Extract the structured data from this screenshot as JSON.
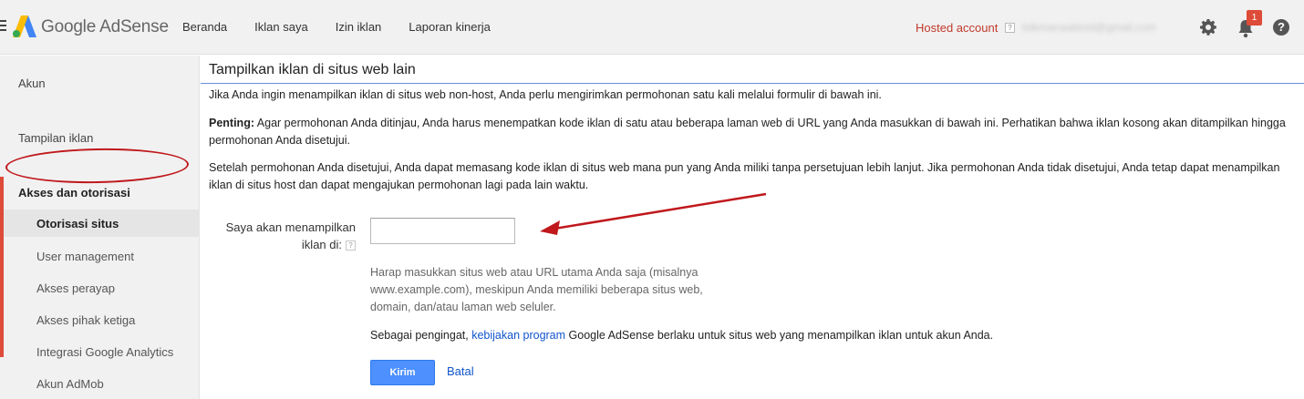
{
  "header": {
    "brand": "Google AdSense",
    "nav": [
      "Beranda",
      "Iklan saya",
      "Izin iklan",
      "Laporan kinerja"
    ],
    "hosted_account": "Hosted account",
    "help_mark": "?",
    "email": "bilkmanaabloid@gmail.com",
    "notification_count": "1",
    "help_icon": "?"
  },
  "sidebar": {
    "akun": "Akun",
    "tampilan_iklan": "Tampilan iklan",
    "section": "Akses dan otorisasi",
    "items": [
      "Otorisasi situs",
      "User management",
      "Akses perayap",
      "Akses pihak ketiga",
      "Integrasi Google Analytics",
      "Akun AdMob"
    ]
  },
  "main": {
    "title": "Tampilkan iklan di situs web lain",
    "para1": "Jika Anda ingin menampilkan iklan di situs web non-host, Anda perlu mengirimkan permohonan satu kali melalui formulir di bawah ini.",
    "important_label": "Penting:",
    "important_text": " Agar permohonan Anda ditinjau, Anda harus menempatkan kode iklan di satu atau beberapa laman web di URL yang Anda masukkan di bawah ini. Perhatikan bahwa iklan kosong akan ditampilkan hingga permohonan Anda disetujui.",
    "para3": "Setelah permohonan Anda disetujui, Anda dapat memasang kode iklan di situs web mana pun yang Anda miliki tanpa persetujuan lebih lanjut. Jika permohonan Anda tidak disetujui, Anda tetap dapat menampilkan iklan di situs host dan dapat mengajukan permohonan lagi pada lain waktu.",
    "field_label": "Saya akan menampilkan iklan di:",
    "field_help": "?",
    "field_value": "",
    "hint": "Harap masukkan situs web atau URL utama Anda saja (misalnya www.example.com), meskipun Anda memiliki beberapa situs web, domain, dan/atau laman web seluler.",
    "reminder_prefix": "Sebagai pengingat, ",
    "reminder_link": "kebijakan program",
    "reminder_suffix": " Google AdSense berlaku untuk situs web yang menampilkan iklan untuk akun Anda.",
    "submit": "Kirim",
    "cancel": "Batal"
  },
  "colors": {
    "accent_red": "#dd4b39",
    "annotation_red": "#c0181c",
    "link_blue": "#1155cc",
    "button_blue": "#4d90fe"
  }
}
